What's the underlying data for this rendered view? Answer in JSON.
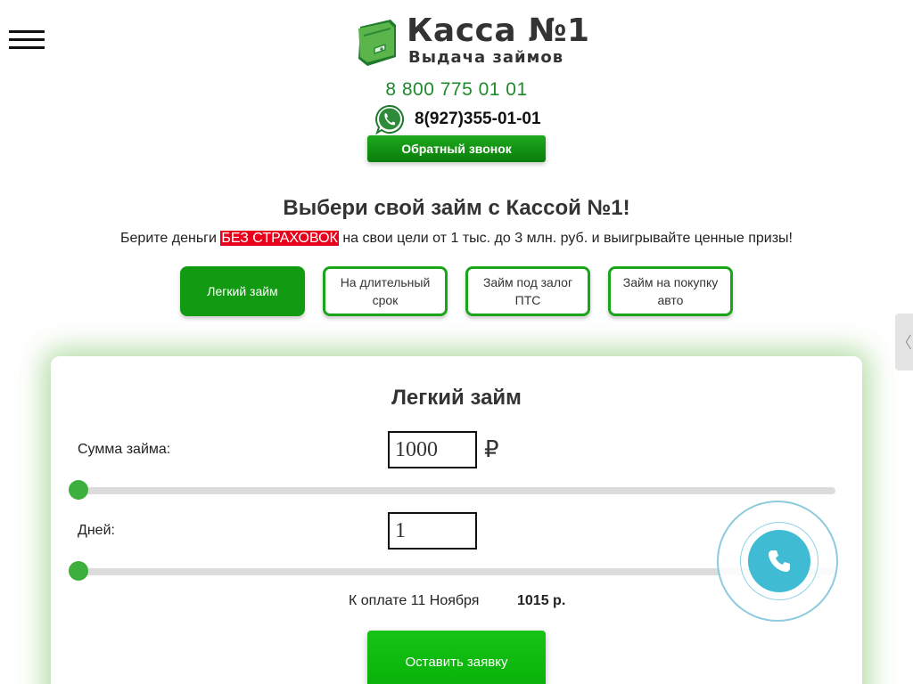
{
  "header": {
    "logo_title": "Касса №1",
    "logo_subtitle": "Выдача займов",
    "phone_main": "8 800 775 01 01",
    "whatsapp_phone": "8(927)355-01-01",
    "callback_label": "Обратный звонок"
  },
  "hero": {
    "headline": "Выбери свой займ с Кассой №1!",
    "sub_before": "Берите деньги ",
    "sub_highlight": "БЕЗ СТРАХОВОК",
    "sub_after": " на свои цели от 1 тыс. до 3 млн. руб. и выигрывайте ценные призы!"
  },
  "tabs": [
    {
      "label": "Легкий займ",
      "active": true
    },
    {
      "label": "На длительный срок",
      "active": false
    },
    {
      "label": "Займ под залог ПТС",
      "active": false
    },
    {
      "label": "Займ на покупку авто",
      "active": false
    }
  ],
  "calculator": {
    "title": "Легкий займ",
    "amount_label": "Сумма займа:",
    "amount_value": "1000",
    "currency_symbol": "₽",
    "days_label": "Дней:",
    "days_value": "1",
    "pay_label": "К оплате 11 Ноября",
    "pay_amount": "1015 р.",
    "submit_label": "Оставить заявку"
  },
  "side_tab_symbol": "〈",
  "icons": {
    "menu": "hamburger-menu-icon",
    "whatsapp": "whatsapp-icon",
    "call": "phone-handset-icon"
  },
  "colors": {
    "brand_green": "#129b12",
    "phone_green": "#1e8a2c",
    "highlight_red": "#e8001c",
    "slider_thumb": "#3caf3c",
    "call_widget": "#3fbcd4"
  }
}
